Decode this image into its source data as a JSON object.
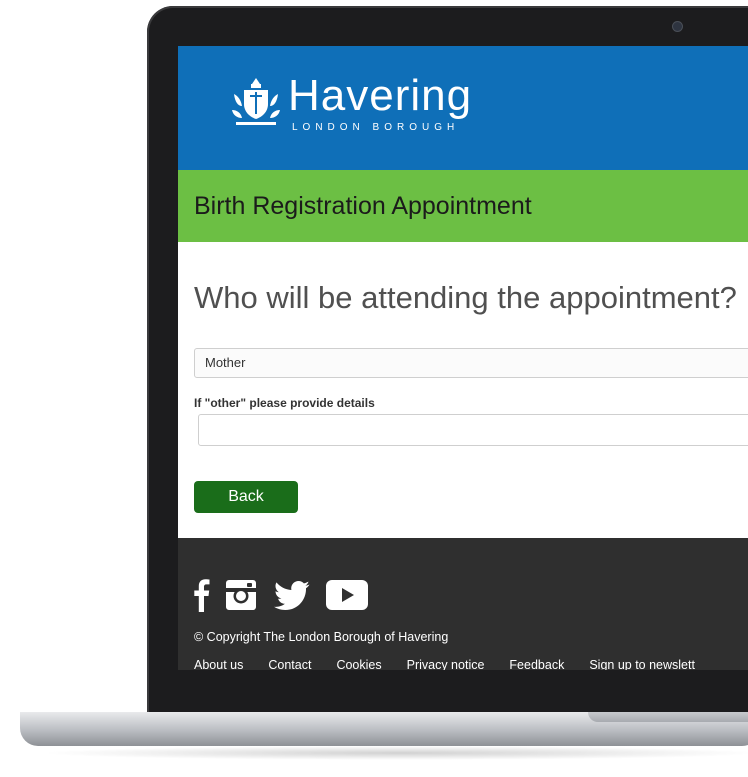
{
  "header": {
    "brand": "Havering",
    "brand_sub": "LONDON BOROUGH",
    "logo_icon": "crest-icon",
    "brand_color": "#0f6fb8"
  },
  "service": {
    "title": "Birth Registration Appointment",
    "color": "#6cbf44"
  },
  "form": {
    "question": "Who will be attending the appointment?",
    "attendee_selected": "Mother",
    "other_label": "If \"other\" please provide details",
    "other_value": "",
    "back_label": "Back",
    "button_color": "#1a6d1a"
  },
  "footer": {
    "social": [
      "facebook-icon",
      "instagram-icon",
      "twitter-icon",
      "youtube-icon"
    ],
    "copyright": "© Copyright The London Borough of Havering",
    "links": [
      "About us",
      "Contact",
      "Cookies",
      "Privacy notice",
      "Feedback",
      "Sign up to newslett"
    ]
  }
}
